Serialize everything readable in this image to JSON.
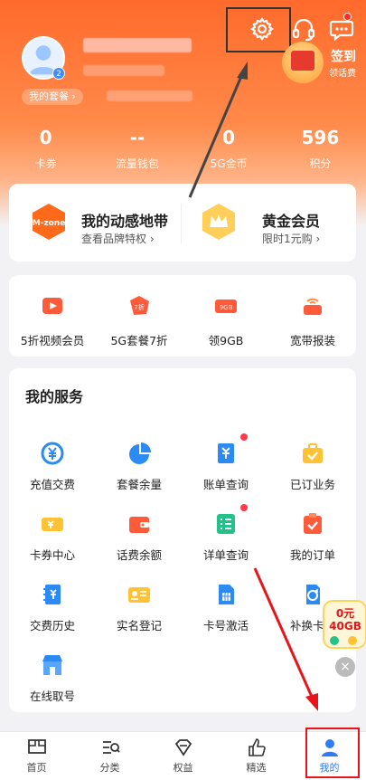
{
  "profile": {
    "plan_label": "我的套餐 ›",
    "avatar_badge": "2"
  },
  "top_icons": [
    "gear-icon",
    "headset-icon",
    "chat-icon"
  ],
  "signin": {
    "title": "签到",
    "subtitle": "领话费"
  },
  "stats": [
    {
      "value": "0",
      "label": "卡券"
    },
    {
      "value": "--",
      "label": "流量钱包"
    },
    {
      "value": "0",
      "label": "5G金币"
    },
    {
      "value": "596",
      "label": "积分"
    }
  ],
  "members": [
    {
      "title": "我的动感地带",
      "subtitle": "查看品牌特权 ›",
      "icon_text": "M-zone"
    },
    {
      "title": "黄金会员",
      "subtitle": "限时1元购 ›"
    }
  ],
  "promos": [
    {
      "label": "5折视频会员",
      "badge": ""
    },
    {
      "label": "5G套餐7折",
      "badge": "7折"
    },
    {
      "label": "领9GB",
      "badge": "9GB"
    },
    {
      "label": "宽带报装",
      "badge": ""
    }
  ],
  "services": {
    "title": "我的服务",
    "items": [
      {
        "label": "充值交费",
        "icon": "yuan-circle-icon"
      },
      {
        "label": "套餐余量",
        "icon": "pie-chart-icon"
      },
      {
        "label": "账单查询",
        "icon": "bill-icon"
      },
      {
        "label": "已订业务",
        "icon": "briefcase-check-icon"
      },
      {
        "label": "卡券中心",
        "icon": "ticket-icon"
      },
      {
        "label": "话费余额",
        "icon": "wallet-icon"
      },
      {
        "label": "详单查询",
        "icon": "list-icon"
      },
      {
        "label": "我的订单",
        "icon": "order-icon"
      },
      {
        "label": "交费历史",
        "icon": "history-icon"
      },
      {
        "label": "实名登记",
        "icon": "id-card-icon"
      },
      {
        "label": "卡号激活",
        "icon": "sim-card-icon"
      },
      {
        "label": "补换卡业",
        "icon": "sim-swap-icon"
      },
      {
        "label": "在线取号",
        "icon": "store-icon"
      }
    ]
  },
  "float_coupon": {
    "line1": "0元",
    "line2": "40GB"
  },
  "tabs": [
    {
      "label": "首页",
      "icon": "home-icon"
    },
    {
      "label": "分类",
      "icon": "category-icon"
    },
    {
      "label": "权益",
      "icon": "diamond-icon"
    },
    {
      "label": "精选",
      "icon": "thumb-icon"
    },
    {
      "label": "我的",
      "icon": "profile-icon",
      "active": true
    }
  ],
  "colors": {
    "accent": "#ff6a2b",
    "tab_active": "#2f7cf6",
    "annotation": "#e8141c"
  }
}
